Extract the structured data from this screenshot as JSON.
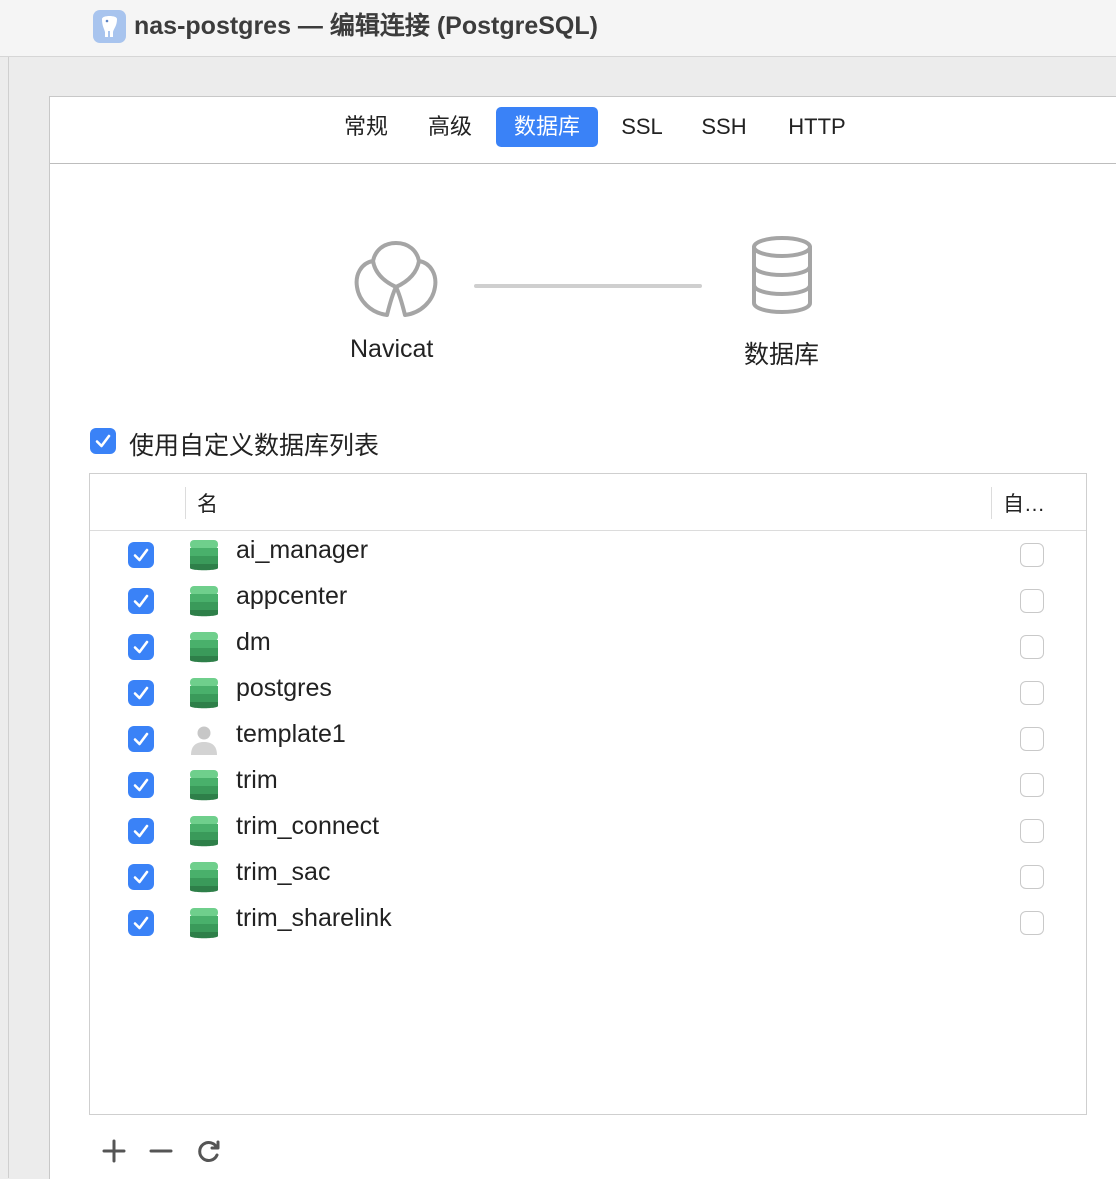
{
  "window": {
    "title": "nas-postgres — 编辑连接 (PostgreSQL)",
    "icon": "postgresql-elephant-icon"
  },
  "tabs": [
    {
      "label": "常规",
      "active": false
    },
    {
      "label": "高级",
      "active": false
    },
    {
      "label": "数据库",
      "active": true
    },
    {
      "label": "SSL",
      "active": false
    },
    {
      "label": "SSH",
      "active": false
    },
    {
      "label": "HTTP",
      "active": false
    }
  ],
  "diagram": {
    "left_label": "Navicat",
    "right_label": "数据库"
  },
  "custom_list": {
    "label": "使用自定义数据库列表",
    "checked": true
  },
  "table": {
    "columns": [
      "名",
      "自…"
    ],
    "rows": [
      {
        "name": "ai_manager",
        "checked": true,
        "icon": "database-icon",
        "auto": false
      },
      {
        "name": "appcenter",
        "checked": true,
        "icon": "database-icon",
        "auto": false
      },
      {
        "name": "dm",
        "checked": true,
        "icon": "database-icon",
        "auto": false
      },
      {
        "name": "postgres",
        "checked": true,
        "icon": "database-icon",
        "auto": false
      },
      {
        "name": "template1",
        "checked": true,
        "icon": "user-icon",
        "auto": false
      },
      {
        "name": "trim",
        "checked": true,
        "icon": "database-icon",
        "auto": false
      },
      {
        "name": "trim_connect",
        "checked": true,
        "icon": "database-icon",
        "auto": false
      },
      {
        "name": "trim_sac",
        "checked": true,
        "icon": "database-icon",
        "auto": false
      },
      {
        "name": "trim_sharelink",
        "checked": true,
        "icon": "database-icon",
        "auto": false
      }
    ]
  },
  "footer_buttons": [
    {
      "icon": "plus-icon"
    },
    {
      "icon": "minus-icon"
    },
    {
      "icon": "refresh-icon"
    }
  ],
  "colors": {
    "accent": "#3a82f7",
    "db_green": "#3fa45f"
  }
}
